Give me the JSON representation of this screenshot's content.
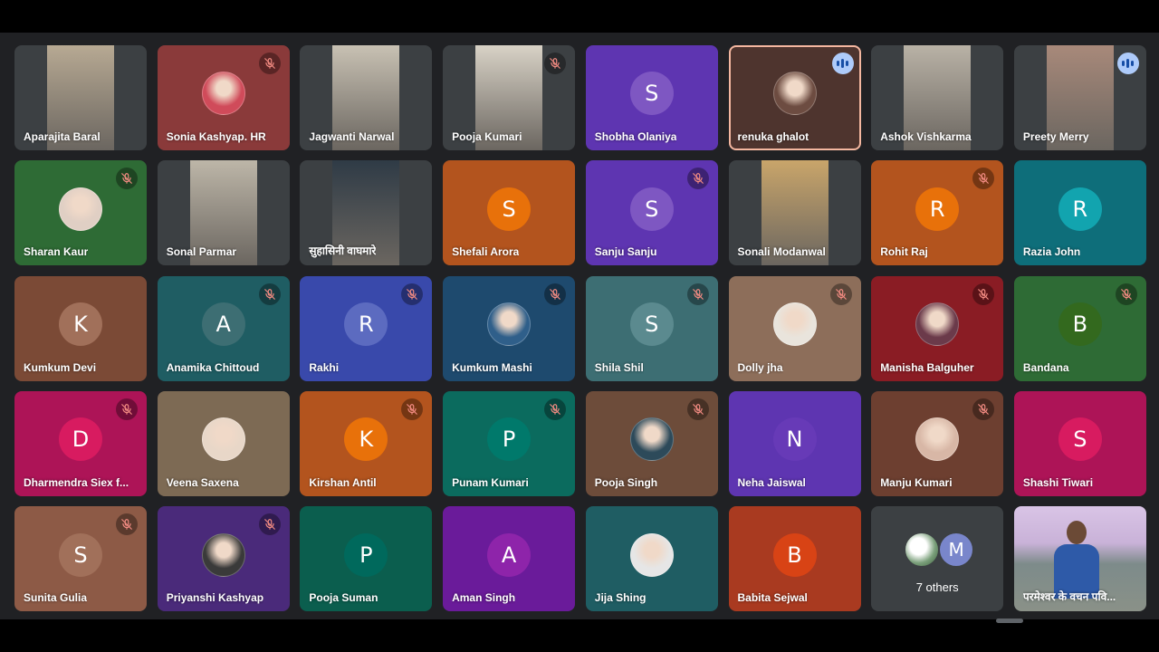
{
  "participants": [
    {
      "name": "Aparajita Baral",
      "bg": "#3c4043",
      "photo": "#b7a993",
      "muted": false
    },
    {
      "name": "Sonia Kashyap. HR",
      "bg": "#8a3a3a",
      "avatar": "img",
      "avatar_color": "#d04b5a",
      "muted": true
    },
    {
      "name": "Jagwanti Narwal",
      "bg": "#3c4043",
      "photo": "#c8c1b3",
      "muted": false
    },
    {
      "name": "Pooja Kumari",
      "bg": "#3c4043",
      "photo": "#d8d2c6",
      "muted": true
    },
    {
      "name": "Shobha Olaniya",
      "bg": "#5e35b1",
      "avatar": "S",
      "avatar_color": "#7e57c2",
      "muted": false
    },
    {
      "name": "renuka ghalot",
      "bg": "#4e342e",
      "avatar": "img",
      "avatar_color": "#6d4c41",
      "speaking": true,
      "muted": false
    },
    {
      "name": "Ashok Vishkarma",
      "bg": "#3c4043",
      "photo": "#b9b2a6",
      "muted": false
    },
    {
      "name": "Preety Merry",
      "bg": "#3c4043",
      "photo": "#a8897a",
      "speaking_indicator": true,
      "muted": false
    },
    {
      "name": "Sharan Kaur",
      "bg": "#2e6b35",
      "avatar": "img",
      "avatar_color": "#e0cfc4",
      "muted": true
    },
    {
      "name": "Sonal Parmar",
      "bg": "#3c4043",
      "photo": "#bdb6a8",
      "muted": false
    },
    {
      "name": "सुहासिनी वाघमारे",
      "bg": "#3c4043",
      "photo": "#2f3b46",
      "muted": false
    },
    {
      "name": "Shefali Arora",
      "bg": "#b3541e",
      "avatar": "S",
      "avatar_color": "#e8710a",
      "muted": false
    },
    {
      "name": "Sanju Sanju",
      "bg": "#5e35b1",
      "avatar": "S",
      "avatar_color": "#7e57c2",
      "muted": true
    },
    {
      "name": "Sonali Modanwal",
      "bg": "#3c4043",
      "photo": "#c9a56a",
      "muted": false
    },
    {
      "name": "Rohit Raj",
      "bg": "#b3541e",
      "avatar": "R",
      "avatar_color": "#e8710a",
      "muted": true
    },
    {
      "name": "Razia John",
      "bg": "#0e6e7a",
      "avatar": "R",
      "avatar_color": "#12a4af",
      "muted": false
    },
    {
      "name": "Kumkum Devi",
      "bg": "#7b4a36",
      "avatar": "K",
      "avatar_color": "#a1705a",
      "muted": false
    },
    {
      "name": "Anamika Chittoud",
      "bg": "#1f5d63",
      "avatar": "A",
      "avatar_color": "#3d6e73",
      "muted": true
    },
    {
      "name": "Rakhi",
      "bg": "#3949ab",
      "avatar": "R",
      "avatar_color": "#5c6bc0",
      "muted": true
    },
    {
      "name": "Kumkum Mashi",
      "bg": "#1e4a6e",
      "avatar": "img",
      "avatar_color": "#2f5f8a",
      "muted": true
    },
    {
      "name": "Shila Shil",
      "bg": "#3d6e73",
      "avatar": "S",
      "avatar_color": "#5b8a8f",
      "muted": true
    },
    {
      "name": "Dolly jha",
      "bg": "#8d6e5a",
      "avatar": "img",
      "avatar_color": "#e9e4dc",
      "muted": true
    },
    {
      "name": "Manisha Balguher",
      "bg": "#8a1c24",
      "avatar": "img",
      "avatar_color": "#6b3a4a",
      "muted": true
    },
    {
      "name": "Bandana",
      "bg": "#2e6b35",
      "avatar": "B",
      "avatar_color": "#33691e",
      "muted": true
    },
    {
      "name": "Dharmendra Siex f...",
      "bg": "#ad1457",
      "avatar": "D",
      "avatar_color": "#d81b60",
      "muted": true
    },
    {
      "name": "Veena Saxena",
      "bg": "#7d6a54",
      "avatar": "img",
      "avatar_color": "#e8d7c8",
      "muted": false
    },
    {
      "name": "Kirshan Antil",
      "bg": "#b3541e",
      "avatar": "K",
      "avatar_color": "#e8710a",
      "muted": true
    },
    {
      "name": "Punam Kumari",
      "bg": "#0b6b5e",
      "avatar": "P",
      "avatar_color": "#00796b",
      "muted": true
    },
    {
      "name": "Pooja Singh",
      "bg": "#6d4c3a",
      "avatar": "img",
      "avatar_color": "#2d4a5a",
      "muted": true
    },
    {
      "name": "Neha Jaiswal",
      "bg": "#5e35b1",
      "avatar": "N",
      "avatar_color": "#673ab7",
      "muted": false
    },
    {
      "name": "Manju Kumari",
      "bg": "#6d3f30",
      "avatar": "img",
      "avatar_color": "#d8b7a6",
      "muted": true
    },
    {
      "name": "Shashi Tiwari",
      "bg": "#ad1457",
      "avatar": "S",
      "avatar_color": "#d81b60",
      "muted": false
    },
    {
      "name": "Sunita Gulia",
      "bg": "#8d5a46",
      "avatar": "S",
      "avatar_color": "#a1705a",
      "muted": true
    },
    {
      "name": "Priyanshi Kashyap",
      "bg": "#4a2a7a",
      "avatar": "img",
      "avatar_color": "#3a3a3a",
      "muted": true
    },
    {
      "name": "Pooja Suman",
      "bg": "#0b5e4e",
      "avatar": "P",
      "avatar_color": "#00695c",
      "muted": false
    },
    {
      "name": "Aman Singh",
      "bg": "#6a1b9a",
      "avatar": "A",
      "avatar_color": "#8e24aa",
      "muted": false
    },
    {
      "name": "Jija Shing",
      "bg": "#1f5d63",
      "avatar": "img",
      "avatar_color": "#e6e6e6",
      "muted": false
    },
    {
      "name": "Babita Sejwal",
      "bg": "#a93a20",
      "avatar": "B",
      "avatar_color": "#d84315",
      "muted": false
    }
  ],
  "others": {
    "label": "7 others",
    "initial": "M"
  },
  "self_tile": {
    "name": "परमेश्वर के वचन पवि..."
  },
  "colors": {
    "muted_bg": "rgba(0,0,0,0.35)",
    "muted_icon": "#f28b82",
    "speaking_border": "#f4b7a0"
  }
}
